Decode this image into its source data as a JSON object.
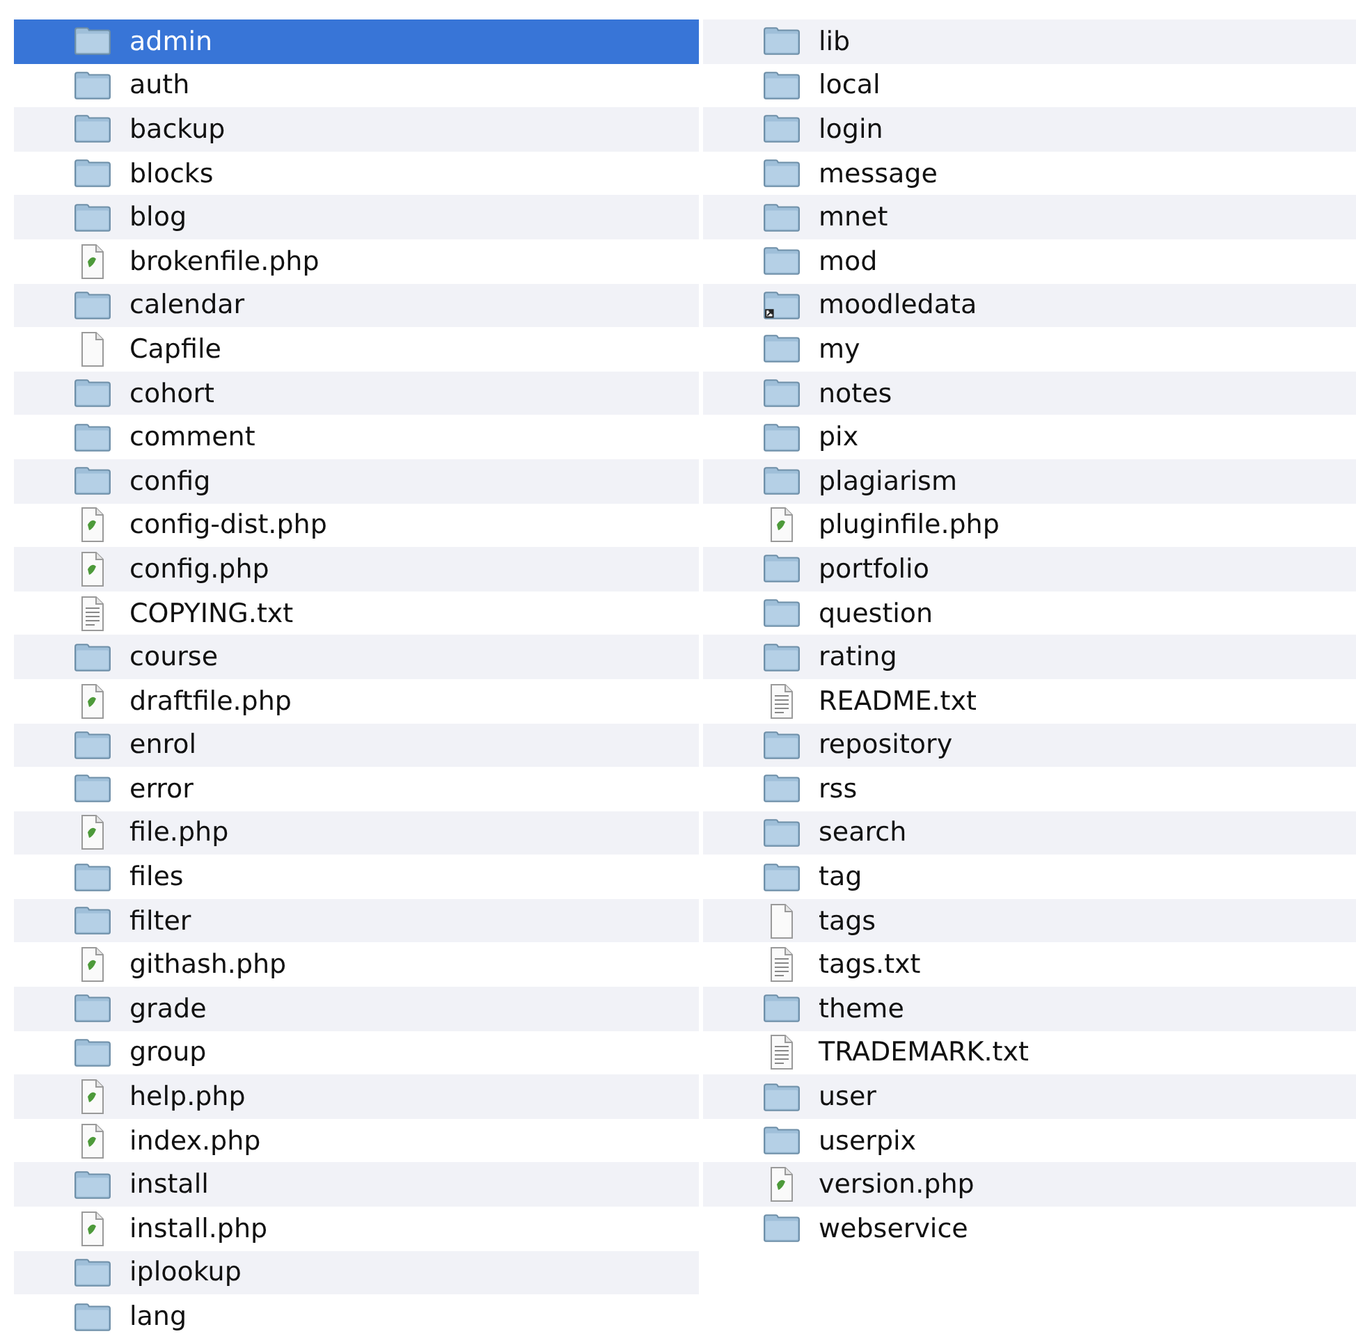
{
  "columns": [
    {
      "items": [
        {
          "name": "admin",
          "kind": "folder",
          "selected": true
        },
        {
          "name": "auth",
          "kind": "folder",
          "selected": false
        },
        {
          "name": "backup",
          "kind": "folder",
          "selected": false
        },
        {
          "name": "blocks",
          "kind": "folder",
          "selected": false
        },
        {
          "name": "blog",
          "kind": "folder",
          "selected": false
        },
        {
          "name": "brokenfile.php",
          "kind": "php",
          "selected": false
        },
        {
          "name": "calendar",
          "kind": "folder",
          "selected": false
        },
        {
          "name": "Capfile",
          "kind": "blank",
          "selected": false
        },
        {
          "name": "cohort",
          "kind": "folder",
          "selected": false
        },
        {
          "name": "comment",
          "kind": "folder",
          "selected": false
        },
        {
          "name": "config",
          "kind": "folder",
          "selected": false
        },
        {
          "name": "config-dist.php",
          "kind": "php",
          "selected": false
        },
        {
          "name": "config.php",
          "kind": "php",
          "selected": false
        },
        {
          "name": "COPYING.txt",
          "kind": "text",
          "selected": false
        },
        {
          "name": "course",
          "kind": "folder",
          "selected": false
        },
        {
          "name": "draftfile.php",
          "kind": "php",
          "selected": false
        },
        {
          "name": "enrol",
          "kind": "folder",
          "selected": false
        },
        {
          "name": "error",
          "kind": "folder",
          "selected": false
        },
        {
          "name": "file.php",
          "kind": "php",
          "selected": false
        },
        {
          "name": "files",
          "kind": "folder",
          "selected": false
        },
        {
          "name": "filter",
          "kind": "folder",
          "selected": false
        },
        {
          "name": "githash.php",
          "kind": "php",
          "selected": false
        },
        {
          "name": "grade",
          "kind": "folder",
          "selected": false
        },
        {
          "name": "group",
          "kind": "folder",
          "selected": false
        },
        {
          "name": "help.php",
          "kind": "php",
          "selected": false
        },
        {
          "name": "index.php",
          "kind": "php",
          "selected": false
        },
        {
          "name": "install",
          "kind": "folder",
          "selected": false
        },
        {
          "name": "install.php",
          "kind": "php",
          "selected": false
        },
        {
          "name": "iplookup",
          "kind": "folder",
          "selected": false
        },
        {
          "name": "lang",
          "kind": "folder",
          "selected": false
        }
      ]
    },
    {
      "items": [
        {
          "name": "lib",
          "kind": "folder",
          "selected": false
        },
        {
          "name": "local",
          "kind": "folder",
          "selected": false
        },
        {
          "name": "login",
          "kind": "folder",
          "selected": false
        },
        {
          "name": "message",
          "kind": "folder",
          "selected": false
        },
        {
          "name": "mnet",
          "kind": "folder",
          "selected": false
        },
        {
          "name": "mod",
          "kind": "folder",
          "selected": false
        },
        {
          "name": "moodledata",
          "kind": "alias",
          "selected": false
        },
        {
          "name": "my",
          "kind": "folder",
          "selected": false
        },
        {
          "name": "notes",
          "kind": "folder",
          "selected": false
        },
        {
          "name": "pix",
          "kind": "folder",
          "selected": false
        },
        {
          "name": "plagiarism",
          "kind": "folder",
          "selected": false
        },
        {
          "name": "pluginfile.php",
          "kind": "php",
          "selected": false
        },
        {
          "name": "portfolio",
          "kind": "folder",
          "selected": false
        },
        {
          "name": "question",
          "kind": "folder",
          "selected": false
        },
        {
          "name": "rating",
          "kind": "folder",
          "selected": false
        },
        {
          "name": "README.txt",
          "kind": "text",
          "selected": false
        },
        {
          "name": "repository",
          "kind": "folder",
          "selected": false
        },
        {
          "name": "rss",
          "kind": "folder",
          "selected": false
        },
        {
          "name": "search",
          "kind": "folder",
          "selected": false
        },
        {
          "name": "tag",
          "kind": "folder",
          "selected": false
        },
        {
          "name": "tags",
          "kind": "blank",
          "selected": false
        },
        {
          "name": "tags.txt",
          "kind": "text",
          "selected": false
        },
        {
          "name": "theme",
          "kind": "folder",
          "selected": false
        },
        {
          "name": "TRADEMARK.txt",
          "kind": "text",
          "selected": false
        },
        {
          "name": "user",
          "kind": "folder",
          "selected": false
        },
        {
          "name": "userpix",
          "kind": "folder",
          "selected": false
        },
        {
          "name": "version.php",
          "kind": "php",
          "selected": false
        },
        {
          "name": "webservice",
          "kind": "folder",
          "selected": false
        }
      ]
    }
  ]
}
